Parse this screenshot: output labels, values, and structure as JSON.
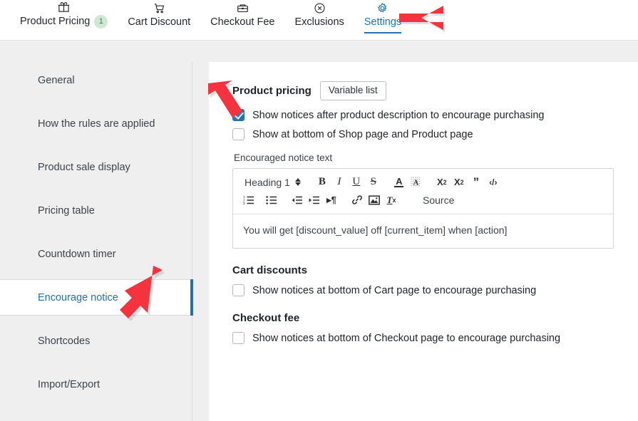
{
  "tabs": [
    {
      "label": "Product Pricing",
      "icon": "gift-icon",
      "badge": "1",
      "active": false
    },
    {
      "label": "Cart Discount",
      "icon": "cart-icon",
      "badge": "",
      "active": false
    },
    {
      "label": "Checkout Fee",
      "icon": "wallet-icon",
      "badge": "",
      "active": false
    },
    {
      "label": "Exclusions",
      "icon": "circle-x-icon",
      "badge": "",
      "active": false
    },
    {
      "label": "Settings",
      "icon": "gear-icon",
      "badge": "",
      "active": true
    }
  ],
  "sidebar": {
    "items": [
      {
        "label": "General",
        "active": false
      },
      {
        "label": "How the rules are applied",
        "active": false
      },
      {
        "label": "Product sale display",
        "active": false
      },
      {
        "label": "Pricing table",
        "active": false
      },
      {
        "label": "Countdown timer",
        "active": false
      },
      {
        "label": "Encourage notice",
        "active": true
      },
      {
        "label": "Shortcodes",
        "active": false
      },
      {
        "label": "Import/Export",
        "active": false
      }
    ]
  },
  "main": {
    "product_pricing": {
      "title": "Product pricing",
      "variable_list_button": "Variable list",
      "checkbox_1": {
        "label": "Show notices after product description to encourage purchasing",
        "checked": true
      },
      "checkbox_2": {
        "label": "Show at bottom of Shop page and Product page",
        "checked": false
      }
    },
    "encouraged_notice": {
      "field_label": "Encouraged notice text",
      "editor": {
        "format_select": "Heading 1",
        "source_button": "Source",
        "toolbar_row_1": [
          "bold-icon",
          "italic-icon",
          "underline-icon",
          "strikethrough-icon",
          "text-color-icon",
          "background-color-icon",
          "subscript-icon",
          "superscript-icon",
          "blockquote-icon",
          "code-icon"
        ],
        "toolbar_row_2": [
          "numbered-list-icon",
          "bulleted-list-icon",
          "outdent-icon",
          "indent-icon",
          "text-direction-icon",
          "link-icon",
          "image-icon",
          "remove-format-icon"
        ],
        "content": "You will get [discount_value] off [current_item] when [action]"
      }
    },
    "cart_discounts": {
      "title": "Cart discounts",
      "checkbox": {
        "label": "Show notices at bottom of Cart page to encourage purchasing",
        "checked": false
      }
    },
    "checkout_fee": {
      "title": "Checkout fee",
      "checkbox": {
        "label": "Show notices at bottom of Checkout page to encourage purchasing",
        "checked": false
      }
    }
  },
  "annotations": {
    "arrows": [
      {
        "name": "arrow-pointing-settings-tab",
        "color": "#f5333f"
      },
      {
        "name": "arrow-pointing-encourage-notice",
        "color": "#f5333f"
      },
      {
        "name": "arrow-pointing-checkbox",
        "color": "#f5333f"
      }
    ]
  },
  "colors": {
    "accent_blue": "#2271b1",
    "arrow_red": "#f5333f",
    "badge_green": "#cfe8d4",
    "page_bg": "#efefef"
  }
}
